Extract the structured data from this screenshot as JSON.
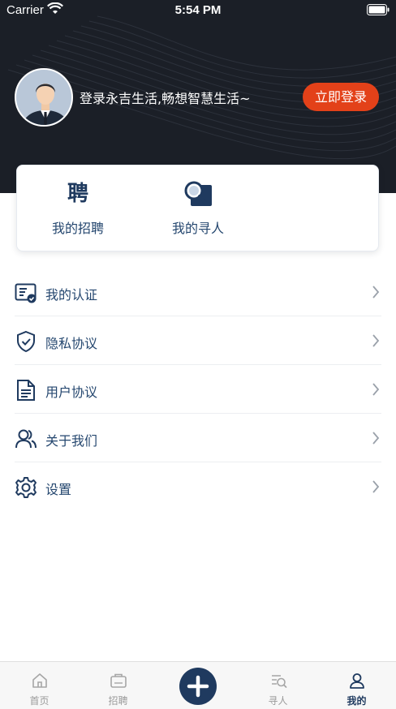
{
  "status_bar": {
    "carrier": "Carrier",
    "time": "5:54 PM"
  },
  "header": {
    "slogan": "登录永吉生活,畅想智慧生活~",
    "login_button": "立即登录",
    "background_color": "#1b1f27",
    "accent_color": "#e34119"
  },
  "quick_actions": [
    {
      "label": "我的招聘",
      "icon": "recruit-icon",
      "glyph": "聘"
    },
    {
      "label": "我的寻人",
      "icon": "search-person-icon"
    }
  ],
  "menu": [
    {
      "label": "我的认证",
      "icon": "certificate-icon"
    },
    {
      "label": "隐私协议",
      "icon": "shield-check-icon"
    },
    {
      "label": "用户协议",
      "icon": "document-icon"
    },
    {
      "label": "关于我们",
      "icon": "users-icon"
    },
    {
      "label": "设置",
      "icon": "gear-icon"
    }
  ],
  "tabbar": {
    "tabs": [
      {
        "label": "首页",
        "icon": "home-icon"
      },
      {
        "label": "招聘",
        "icon": "job-icon"
      },
      {
        "label": "寻人",
        "icon": "find-icon"
      },
      {
        "label": "我的",
        "icon": "profile-icon",
        "active": true
      }
    ],
    "center_icon": "plus-icon",
    "active_color": "#1f3a5f"
  }
}
